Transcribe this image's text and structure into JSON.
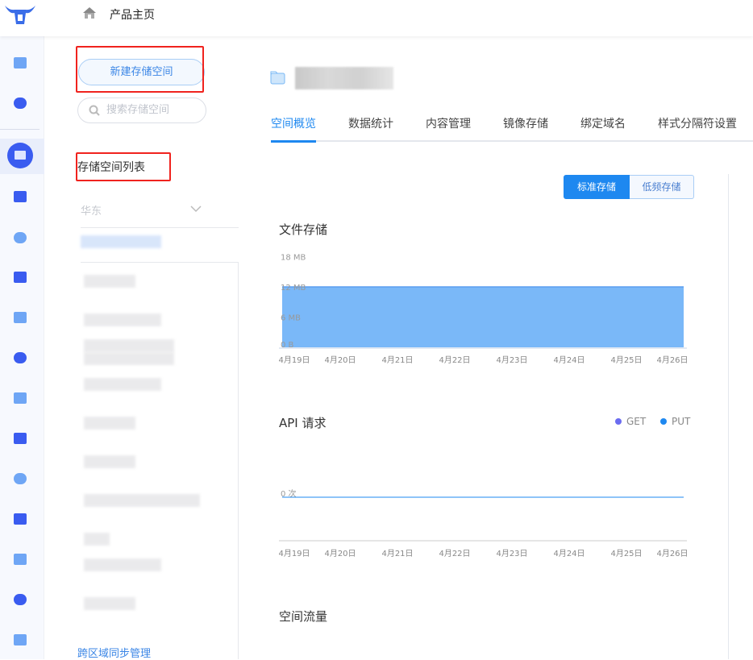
{
  "header": {
    "title": "产品主页",
    "logo_icon": "bull-logo-icon",
    "home_icon": "home-icon"
  },
  "rail": {
    "icons": [
      "id-card-icon",
      "yen-icon",
      "storage-icon",
      "server-icon",
      "cloud-icon",
      "video-icon",
      "sliders-icon",
      "media-icon",
      "cdn-icon",
      "database-icon",
      "security-icon",
      "flash-icon",
      "network-icon",
      "pipeline-icon",
      "book-icon"
    ],
    "active": "storage-icon",
    "accent": "#3a5cf0"
  },
  "sidebar": {
    "new_button": "新建存储空间",
    "search_placeholder": "搜索存储空间",
    "list_title": "存储空间列表",
    "region": "华东",
    "sync_link": "跨区域同步管理"
  },
  "main": {
    "tabs": [
      {
        "label": "空间概览",
        "active": true
      },
      {
        "label": "数据统计"
      },
      {
        "label": "内容管理"
      },
      {
        "label": "镜像存储"
      },
      {
        "label": "绑定域名"
      },
      {
        "label": "样式分隔符设置"
      }
    ],
    "storage_toggle": {
      "options": [
        "标准存储",
        "低频存储"
      ],
      "selected": "标准存储"
    },
    "section_traffic": "空间流量"
  },
  "chart_data": [
    {
      "type": "area",
      "title": "文件存储",
      "categories": [
        "4月19日",
        "4月20日",
        "4月21日",
        "4月22日",
        "4月23日",
        "4月24日",
        "4月25日",
        "4月26日"
      ],
      "yticks": [
        "0 B",
        "6 MB",
        "12 MB",
        "18 MB"
      ],
      "ylim": [
        0,
        18
      ],
      "unit": "MB",
      "values": [
        12,
        12,
        12,
        12,
        12,
        12,
        12,
        12
      ],
      "color": "#7ab8f8"
    },
    {
      "type": "line",
      "title": "API 请求",
      "categories": [
        "4月19日",
        "4月20日",
        "4月21日",
        "4月22日",
        "4月23日",
        "4月24日",
        "4月25日",
        "4月26日"
      ],
      "yticks": [
        "0 次"
      ],
      "series": [
        {
          "name": "GET",
          "values": [
            0,
            0,
            0,
            0,
            0,
            0,
            0,
            0
          ],
          "color": "#6b6cf0"
        },
        {
          "name": "PUT",
          "values": [
            0,
            0,
            0,
            0,
            0,
            0,
            0,
            0
          ],
          "color": "#1e88f0"
        }
      ],
      "legend": "top-right"
    }
  ]
}
